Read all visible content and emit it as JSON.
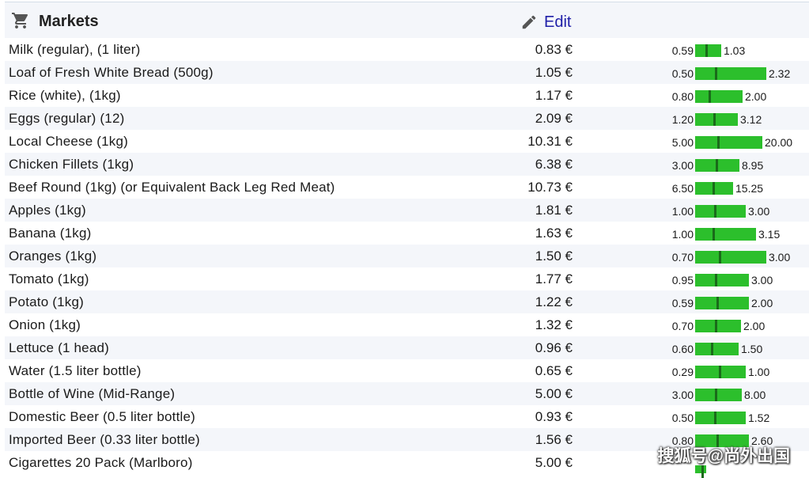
{
  "header": {
    "title": "Markets",
    "edit_label": "Edit"
  },
  "icons": {
    "cart": "cart-icon",
    "edit": "pencil-icon"
  },
  "colors": {
    "bar": "#2cbf2c",
    "marker": "#1a6b1a",
    "link": "#1f1fa8",
    "stripe": "#f4f6fa"
  },
  "rows": [
    {
      "item": "Milk (regular), (1 liter)",
      "price": "0.83 €",
      "min": "0.59",
      "max": "1.03"
    },
    {
      "item": "Loaf of Fresh White Bread (500g)",
      "price": "1.05 €",
      "min": "0.50",
      "max": "2.32"
    },
    {
      "item": "Rice (white), (1kg)",
      "price": "1.17 €",
      "min": "0.80",
      "max": "2.00"
    },
    {
      "item": "Eggs (regular) (12)",
      "price": "2.09 €",
      "min": "1.20",
      "max": "3.12"
    },
    {
      "item": "Local Cheese (1kg)",
      "price": "10.31 €",
      "min": "5.00",
      "max": "20.00"
    },
    {
      "item": "Chicken Fillets (1kg)",
      "price": "6.38 €",
      "min": "3.00",
      "max": "8.95"
    },
    {
      "item": "Beef Round (1kg) (or Equivalent Back Leg Red Meat)",
      "price": "10.73 €",
      "min": "6.50",
      "max": "15.25"
    },
    {
      "item": "Apples (1kg)",
      "price": "1.81 €",
      "min": "1.00",
      "max": "3.00"
    },
    {
      "item": "Banana (1kg)",
      "price": "1.63 €",
      "min": "1.00",
      "max": "3.15"
    },
    {
      "item": "Oranges (1kg)",
      "price": "1.50 €",
      "min": "0.70",
      "max": "3.00"
    },
    {
      "item": "Tomato (1kg)",
      "price": "1.77 €",
      "min": "0.95",
      "max": "3.00"
    },
    {
      "item": "Potato (1kg)",
      "price": "1.22 €",
      "min": "0.59",
      "max": "2.00"
    },
    {
      "item": "Onion (1kg)",
      "price": "1.32 €",
      "min": "0.70",
      "max": "2.00"
    },
    {
      "item": "Lettuce (1 head)",
      "price": "0.96 €",
      "min": "0.60",
      "max": "1.50"
    },
    {
      "item": "Water (1.5 liter bottle)",
      "price": "0.65 €",
      "min": "0.29",
      "max": "1.00"
    },
    {
      "item": "Bottle of Wine (Mid-Range)",
      "price": "5.00 €",
      "min": "3.00",
      "max": "8.00"
    },
    {
      "item": "Domestic Beer (0.5 liter bottle)",
      "price": "0.93 €",
      "min": "0.50",
      "max": "1.52"
    },
    {
      "item": "Imported Beer (0.33 liter bottle)",
      "price": "1.56 €",
      "min": "0.80",
      "max": "2.60"
    },
    {
      "item": "Cigarettes 20 Pack (Marlboro)",
      "price": "5.00 €",
      "min": "",
      "max": ""
    }
  ],
  "watermark": "搜狐号@尚外出国"
}
